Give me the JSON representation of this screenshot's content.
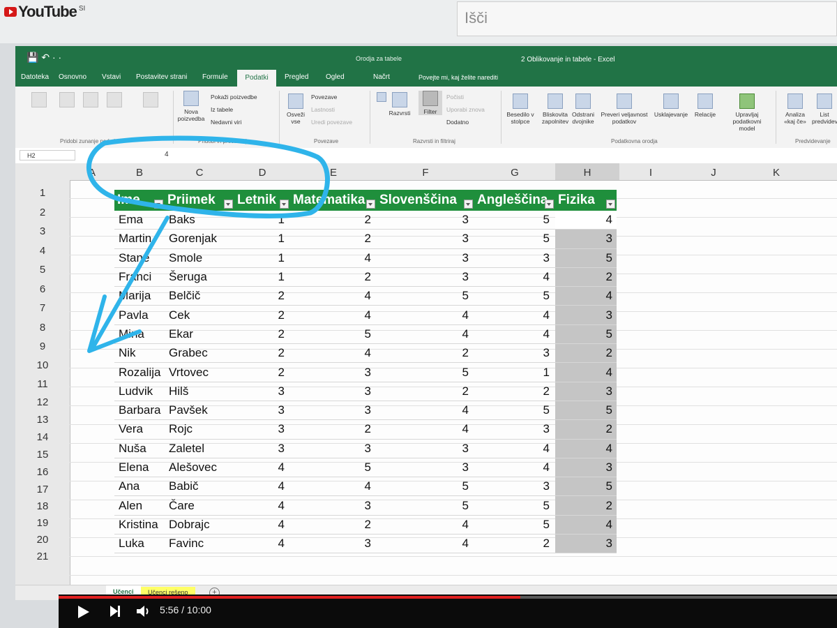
{
  "youtube": {
    "logo": "YouTube",
    "region": "SI",
    "search_placeholder": "Išči"
  },
  "excel": {
    "qat": "💾  ↶ ·  ·",
    "context_title": "Orodja za tabele",
    "doc_title": "2 Oblikovanje in tabele  -  Excel",
    "tabs": [
      "Datoteka",
      "Osnovno",
      "Vstavi",
      "Postavitev strani",
      "Formule",
      "Podatki",
      "Pregled",
      "Ogled"
    ],
    "active_tab": "Podatki",
    "tab_nacrt": "Načrt",
    "tell_me": "Povejte mi, kaj želite narediti",
    "ribbon": {
      "nova_poizvedba": "Nova poizvedba",
      "pokazi_poizvedbe": "Pokaži poizvedbe",
      "iz_tabele": "Iz tabele",
      "nedavni_viri": "Nedavni viri",
      "osvezi_vse": "Osveži vse",
      "povezave": "Povezave",
      "lastnosti": "Lastnosti",
      "uredi_povezave": "Uredi povezave",
      "razvrsti": "Razvrsti",
      "filter": "Filter",
      "pocisti": "Počisti",
      "uporabi_znova": "Uporabi znova",
      "dodatno": "Dodatno",
      "besedilo": "Besedilo v stolpce",
      "bliskovita": "Bliskovita zapolnitev",
      "odstrani": "Odstrani dvojnike",
      "preveri": "Preveri veljavnost podatkov",
      "usklajevanje": "Usklajevanje",
      "relacije": "Relacije",
      "upravljaj": "Upravljaj podatkovni model",
      "analiza": "Analiza «kaj če»",
      "list_napovedi": "List predvidev",
      "grp_zunanji": "Pridobi zunanje podatke",
      "grp_pridobi": "Pridobi in preoblikuj",
      "grp_povezave": "Povezave",
      "grp_razvrsti": "Razvrsti in filtriraj",
      "grp_orodja": "Podatkovna orodja",
      "grp_predvidevanje": "Predvidevanje"
    },
    "namebox": "H2",
    "formula_value": "4",
    "columns": [
      "A",
      "B",
      "C",
      "D",
      "E",
      "F",
      "G",
      "H",
      "I",
      "J",
      "K"
    ],
    "rows": [
      "1",
      "2",
      "3",
      "4",
      "5",
      "6",
      "7",
      "8",
      "9",
      "10",
      "11",
      "12",
      "13",
      "14",
      "15",
      "16",
      "17",
      "18",
      "19",
      "20",
      "21"
    ],
    "table": {
      "headers": [
        "Ime",
        "Priimek",
        "Letnik",
        "Matematika",
        "Slovenščina",
        "Angleščina",
        "Fizika"
      ],
      "rows": [
        [
          "Ema",
          "Baks",
          "1",
          "2",
          "3",
          "5",
          "4"
        ],
        [
          "Martin",
          "Gorenjak",
          "1",
          "2",
          "3",
          "5",
          "3"
        ],
        [
          "Stane",
          "Smole",
          "1",
          "4",
          "3",
          "3",
          "5"
        ],
        [
          "Franci",
          "Šeruga",
          "1",
          "2",
          "3",
          "4",
          "2"
        ],
        [
          "Marija",
          "Belčič",
          "2",
          "4",
          "5",
          "5",
          "4"
        ],
        [
          "Pavla",
          "Cek",
          "2",
          "4",
          "4",
          "4",
          "3"
        ],
        [
          "Mina",
          "Ekar",
          "2",
          "5",
          "4",
          "4",
          "5"
        ],
        [
          "Nik",
          "Grabec",
          "2",
          "4",
          "2",
          "3",
          "2"
        ],
        [
          "Rozalija",
          "Vrtovec",
          "2",
          "3",
          "5",
          "1",
          "4"
        ],
        [
          "Ludvik",
          "Hilš",
          "3",
          "3",
          "2",
          "2",
          "3"
        ],
        [
          "Barbara",
          "Pavšek",
          "3",
          "3",
          "4",
          "5",
          "5"
        ],
        [
          "Vera",
          "Rojc",
          "3",
          "2",
          "4",
          "3",
          "2"
        ],
        [
          "Nuša",
          "Zaletel",
          "3",
          "3",
          "3",
          "4",
          "4"
        ],
        [
          "Elena",
          "Alešovec",
          "4",
          "5",
          "3",
          "4",
          "3"
        ],
        [
          "Ana",
          "Babič",
          "4",
          "4",
          "5",
          "3",
          "5"
        ],
        [
          "Alen",
          "Čare",
          "4",
          "3",
          "5",
          "5",
          "2"
        ],
        [
          "Kristina",
          "Dobrajc",
          "4",
          "2",
          "4",
          "5",
          "4"
        ],
        [
          "Luka",
          "Favinc",
          "4",
          "3",
          "4",
          "2",
          "3"
        ]
      ]
    },
    "sheets": [
      "Učenci",
      "Učenci rešeno"
    ]
  },
  "player": {
    "time": "5:56 / 10:00",
    "progress": 0.593
  },
  "colors": {
    "excel_green": "#217346",
    "header_green": "#1f8f3c",
    "annotation_blue": "#2fb4ea",
    "yt_red": "#e02020"
  }
}
